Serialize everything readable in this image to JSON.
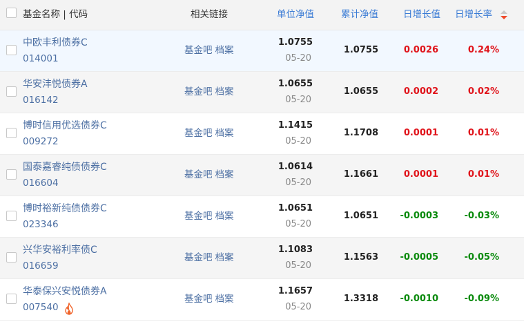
{
  "header": {
    "name_code": "基金名称 | 代码",
    "links": "相关链接",
    "unit_nav": "单位净值",
    "accum_nav": "累计净值",
    "daily_change_value": "日增长值",
    "daily_change_rate": "日增长率",
    "sort_icon": "sort-desc-icon"
  },
  "colors": {
    "link": "#4c6fa3",
    "header_link": "#3a7bd5",
    "up": "#e0141b",
    "down": "#098a0c",
    "header_bg": "#f3f3f3",
    "highlight_row": "#f2f8ff",
    "alt_row": "#f5f5f5",
    "sort_icon_accent": "#f04a2b"
  },
  "rows": [
    {
      "name": "中欧丰利债券C",
      "code": "014001",
      "link1": "基金吧",
      "link2": "档案",
      "unit_nav": "1.0755",
      "date": "05-20",
      "accum_nav": "1.0755",
      "change_value": "0.0026",
      "change_rate": "0.24%",
      "direction": "up"
    },
    {
      "name": "华安沣悦债券A",
      "code": "016142",
      "link1": "基金吧",
      "link2": "档案",
      "unit_nav": "1.0655",
      "date": "05-20",
      "accum_nav": "1.0655",
      "change_value": "0.0002",
      "change_rate": "0.02%",
      "direction": "up"
    },
    {
      "name": "博时信用优选债券C",
      "code": "009272",
      "link1": "基金吧",
      "link2": "档案",
      "unit_nav": "1.1415",
      "date": "05-20",
      "accum_nav": "1.1708",
      "change_value": "0.0001",
      "change_rate": "0.01%",
      "direction": "up"
    },
    {
      "name": "国泰嘉睿纯债债券C",
      "code": "016604",
      "link1": "基金吧",
      "link2": "档案",
      "unit_nav": "1.0614",
      "date": "05-20",
      "accum_nav": "1.1661",
      "change_value": "0.0001",
      "change_rate": "0.01%",
      "direction": "up"
    },
    {
      "name": "博时裕新纯债债券C",
      "code": "023346",
      "link1": "基金吧",
      "link2": "档案",
      "unit_nav": "1.0651",
      "date": "05-20",
      "accum_nav": "1.0651",
      "change_value": "-0.0003",
      "change_rate": "-0.03%",
      "direction": "down"
    },
    {
      "name": "兴华安裕利率债C",
      "code": "016659",
      "link1": "基金吧",
      "link2": "档案",
      "unit_nav": "1.1083",
      "date": "05-20",
      "accum_nav": "1.1563",
      "change_value": "-0.0005",
      "change_rate": "-0.05%",
      "direction": "down"
    },
    {
      "name": "华泰保兴安悦债券A",
      "code": "007540",
      "link1": "基金吧",
      "link2": "档案",
      "unit_nav": "1.1657",
      "date": "05-20",
      "accum_nav": "1.3318",
      "change_value": "-0.0010",
      "change_rate": "-0.09%",
      "direction": "down",
      "badge_icon": "fire-icon"
    }
  ]
}
